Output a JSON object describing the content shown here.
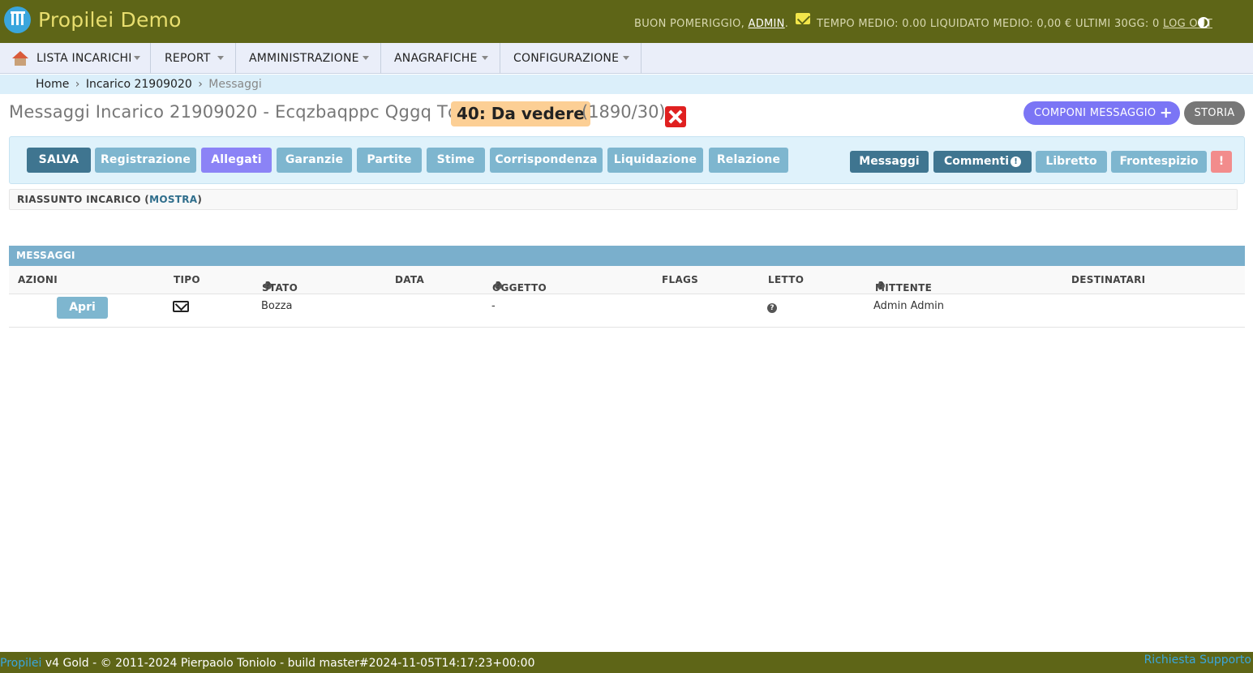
{
  "header": {
    "app_title": "Propilei Demo",
    "greeting": "BUON POMERIGGIO,",
    "user": "ADMIN",
    "stats": "TEMPO MEDIO: 0.00 LIQUIDATO MEDIO: 0,00 € ULTIMI 30GG: 0",
    "logout": "LOG OUT"
  },
  "nav": {
    "items": [
      {
        "label": "LISTA INCARICHI"
      },
      {
        "label": "REPORT"
      },
      {
        "label": "AMMINISTRAZIONE"
      },
      {
        "label": "ANAGRAFICHE"
      },
      {
        "label": "CONFIGURAZIONE"
      }
    ]
  },
  "breadcrumb": {
    "home": "Home",
    "incarico": "Incarico 21909020",
    "current": "Messaggi",
    "sep": "›"
  },
  "page": {
    "title": "Messaggi Incarico 21909020 - Ecqzbaqppc Qggq Tqncq",
    "status": "40: Da vedere",
    "counts": "(1890/30)",
    "compose": "COMPONI MESSAGGIO",
    "history": "STORIA"
  },
  "toolbar": {
    "left": [
      {
        "label": "SALVA"
      },
      {
        "label": "Registrazione"
      },
      {
        "label": "Allegati"
      },
      {
        "label": "Garanzie"
      },
      {
        "label": "Partite"
      },
      {
        "label": "Stime"
      },
      {
        "label": "Corrispondenza"
      },
      {
        "label": "Liquidazione"
      },
      {
        "label": "Relazione"
      }
    ],
    "right": [
      {
        "label": "Messaggi"
      },
      {
        "label": "Commenti"
      },
      {
        "label": "Libretto"
      },
      {
        "label": "Frontespizio"
      },
      {
        "label": "!"
      }
    ]
  },
  "summary": {
    "label": "RIASSUNTO INCARICO (",
    "link": "MOSTRA",
    "close": ")"
  },
  "messages": {
    "title": "MESSAGGI",
    "columns": [
      "AZIONI",
      "TIPO",
      "STATO",
      "DATA",
      "OGGETTO",
      "FLAGS",
      "LETTO",
      "MITTENTE",
      "DESTINATARI"
    ],
    "rows": [
      {
        "action": "Apri",
        "tipo_icon": "envelope-icon",
        "stato": "Bozza",
        "data": "",
        "oggetto": "-",
        "flags": "",
        "letto_icon": "question-icon",
        "mittente": "Admin Admin",
        "destinatari": ""
      }
    ]
  },
  "footer": {
    "brand": "Propilei",
    "text": "v4 Gold - © 2011-2024 Pierpaolo Toniolo - build master#2024-11-05T14:17:23+00:00",
    "support": "Richiesta Supporto"
  },
  "colors": {
    "header_bg": "#5e6517",
    "accent": "#7eb6cf",
    "primary": "#3f7590",
    "purple": "#7b75f5",
    "status_badge": "#fccf95"
  }
}
